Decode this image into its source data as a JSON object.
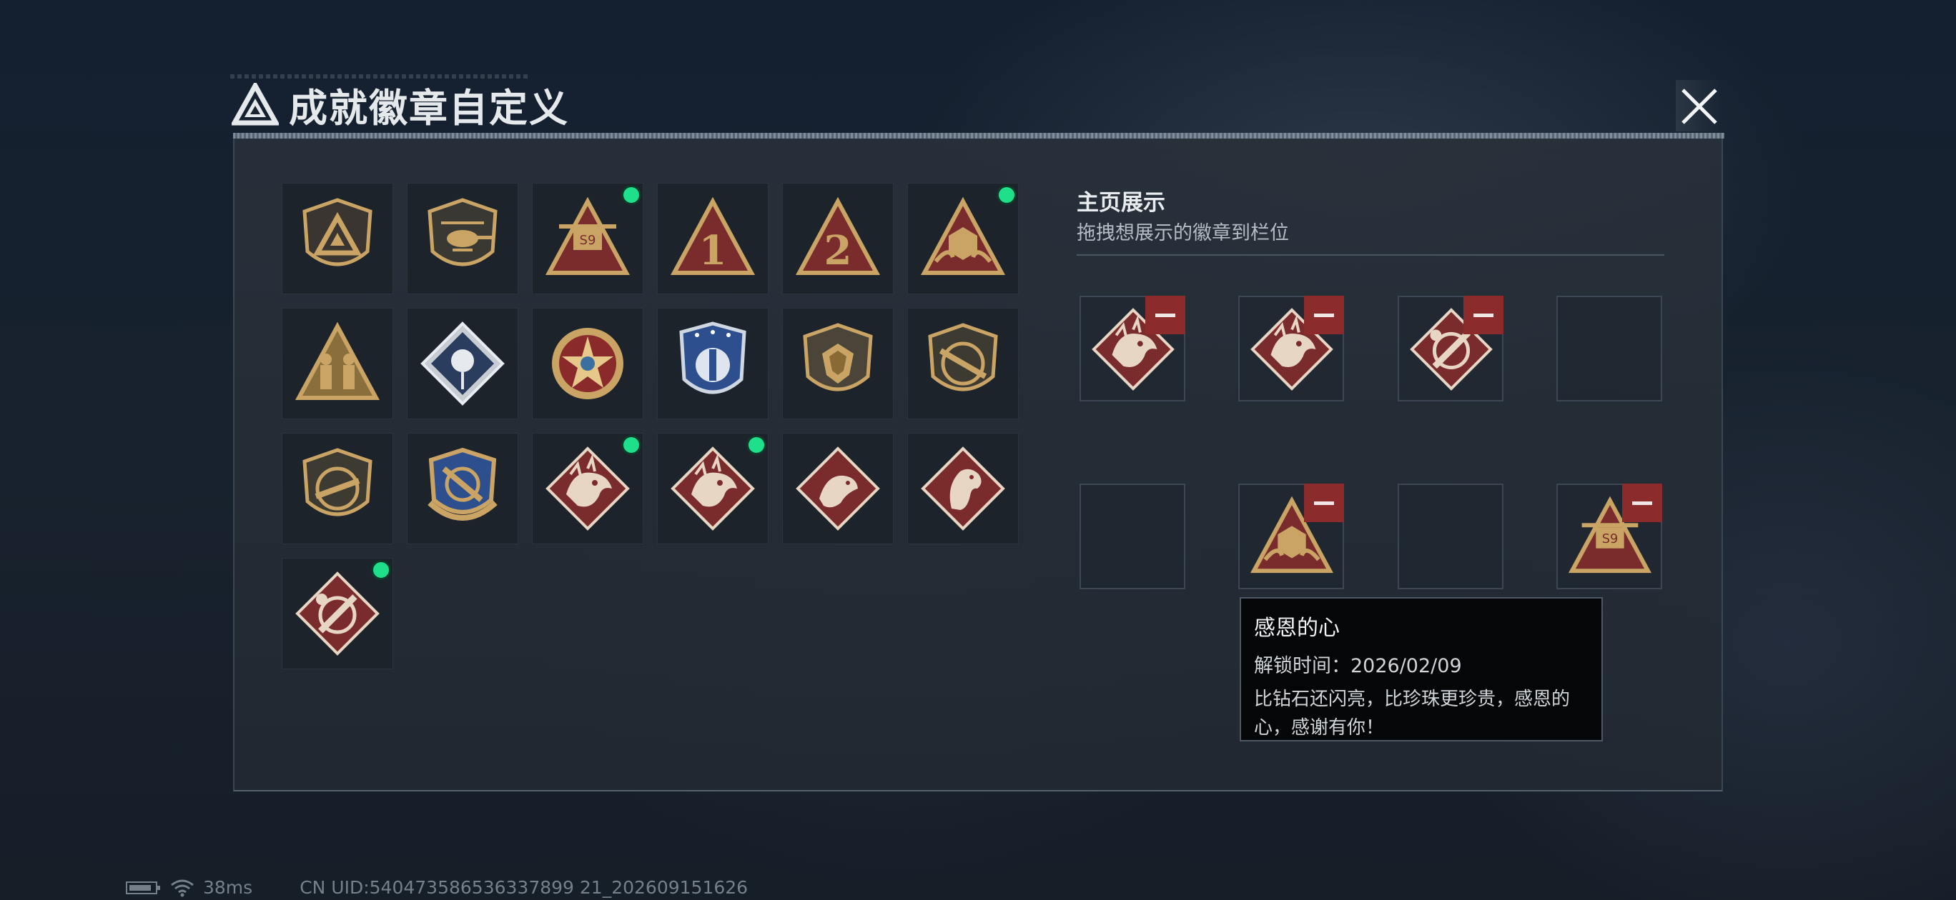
{
  "header": {
    "title": "成就徽章自定义",
    "close_icon": "close-icon"
  },
  "badge_grid": {
    "items": [
      {
        "icon": "delta-logo-shield-badge",
        "new": false
      },
      {
        "icon": "helicopter-shield-badge",
        "new": false
      },
      {
        "icon": "s9-turret-triangle-badge",
        "new": true
      },
      {
        "icon": "number-1-triangle-badge",
        "new": false
      },
      {
        "icon": "number-2-triangle-badge",
        "new": false
      },
      {
        "icon": "d20-hands-triangle-badge",
        "new": true
      },
      {
        "icon": "soldiers-triangle-badge",
        "new": false
      },
      {
        "icon": "rose-diamond-badge",
        "new": false
      },
      {
        "icon": "star-medal-badge",
        "new": false
      },
      {
        "icon": "blue-shield-badge",
        "new": false
      },
      {
        "icon": "gem-shield-badge",
        "new": false
      },
      {
        "icon": "rifle-shield-badge",
        "new": false
      },
      {
        "icon": "smg-shield-badge",
        "new": false
      },
      {
        "icon": "crossed-weapons-laurel-badge",
        "new": false
      },
      {
        "icon": "dragon-diamond-badge",
        "new": true
      },
      {
        "icon": "dragon-diamond-badge",
        "new": true
      },
      {
        "icon": "rat-diamond-badge",
        "new": false
      },
      {
        "icon": "horse-diamond-badge",
        "new": false
      },
      {
        "icon": "wrench-diamond-badge",
        "new": true
      }
    ]
  },
  "display": {
    "title": "主页展示",
    "subtitle": "拖拽想展示的徽章到栏位",
    "slots": [
      {
        "icon": "dragon-diamond-badge",
        "filled": true
      },
      {
        "icon": "dragon-diamond-badge",
        "filled": true
      },
      {
        "icon": "wrench-diamond-badge",
        "filled": true
      },
      {
        "icon": "",
        "filled": false
      },
      {
        "icon": "",
        "filled": false
      },
      {
        "icon": "d20-hands-triangle-badge",
        "filled": true
      },
      {
        "icon": "",
        "filled": false
      },
      {
        "icon": "s9-turret-triangle-badge",
        "filled": true
      }
    ]
  },
  "tooltip": {
    "name": "感恩的心",
    "unlock_time": "解锁时间：2026/02/09",
    "description": "比钻石还闪亮，比珍珠更珍贵，感恩的心，感谢有你！"
  },
  "status_bar": {
    "ping": "38ms",
    "uid": "CN UID:540473586536337899 21_202609151626"
  },
  "colors": {
    "new_dot": "#1ee08a",
    "remove_button": "#8c2b2b",
    "gold": "#c9a465",
    "badge_red": "#7a2c2c"
  }
}
